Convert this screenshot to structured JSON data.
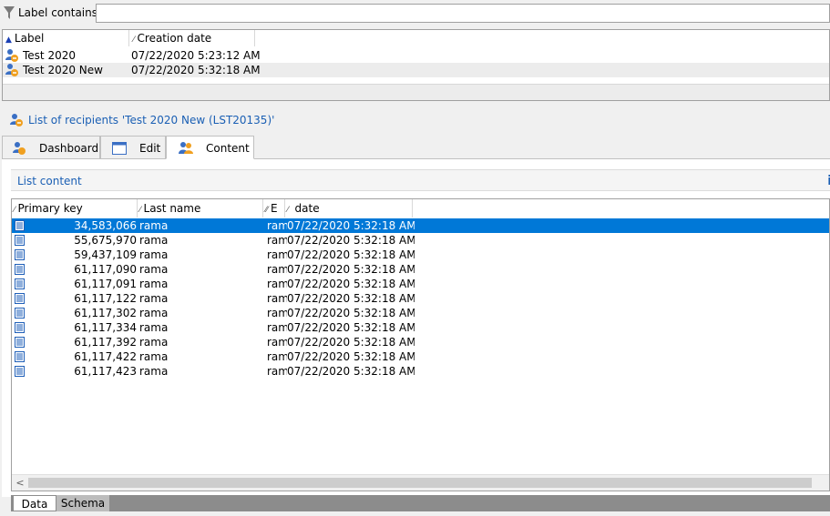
{
  "filter": {
    "label": "Label contains:",
    "value": ""
  },
  "top_list": {
    "columns": [
      "Label",
      "Creation date"
    ],
    "rows": [
      {
        "label": "Test 2020",
        "date": "07/22/2020 5:23:12 AM"
      },
      {
        "label": "Test 2020 New",
        "date": "07/22/2020 5:32:18 AM"
      }
    ]
  },
  "recipients_title": "List of recipients 'Test 2020 New (LST20135)'",
  "tabs": [
    {
      "label": "Dashboard",
      "icon": "recipients-icon"
    },
    {
      "label": "Edit",
      "icon": "window-icon"
    },
    {
      "label": "Content",
      "icon": "people-icon"
    }
  ],
  "list_content_label": "List content",
  "info_icon": "i",
  "grid": {
    "columns": [
      "Primary key",
      "Last name",
      "E",
      "date"
    ],
    "rows": [
      {
        "key": "34,583,066",
        "last": "rama",
        "email": "ram",
        "date": "07/22/2020 5:32:18 AM"
      },
      {
        "key": "55,675,970",
        "last": "rama",
        "email": "ram",
        "date": "07/22/2020 5:32:18 AM"
      },
      {
        "key": "59,437,109",
        "last": "rama",
        "email": "ram",
        "date": "07/22/2020 5:32:18 AM"
      },
      {
        "key": "61,117,090",
        "last": "rama",
        "email": "ram",
        "date": "07/22/2020 5:32:18 AM"
      },
      {
        "key": "61,117,091",
        "last": "rama",
        "email": "ram",
        "date": "07/22/2020 5:32:18 AM"
      },
      {
        "key": "61,117,122",
        "last": "rama",
        "email": "ram",
        "date": "07/22/2020 5:32:18 AM"
      },
      {
        "key": "61,117,302",
        "last": "rama",
        "email": "ram",
        "date": "07/22/2020 5:32:18 AM"
      },
      {
        "key": "61,117,334",
        "last": "rama",
        "email": "ram",
        "date": "07/22/2020 5:32:18 AM"
      },
      {
        "key": "61,117,392",
        "last": "rama",
        "email": "ram",
        "date": "07/22/2020 5:32:18 AM"
      },
      {
        "key": "61,117,422",
        "last": "rama",
        "email": "ram",
        "date": "07/22/2020 5:32:18 AM"
      },
      {
        "key": "61,117,423",
        "last": "rama",
        "email": "ram",
        "date": "07/22/2020 5:32:18 AM"
      }
    ]
  },
  "bottom_tabs": [
    "Data",
    "Schema"
  ],
  "colors": {
    "selection": "#0078d7",
    "link": "#1a5fb4"
  }
}
